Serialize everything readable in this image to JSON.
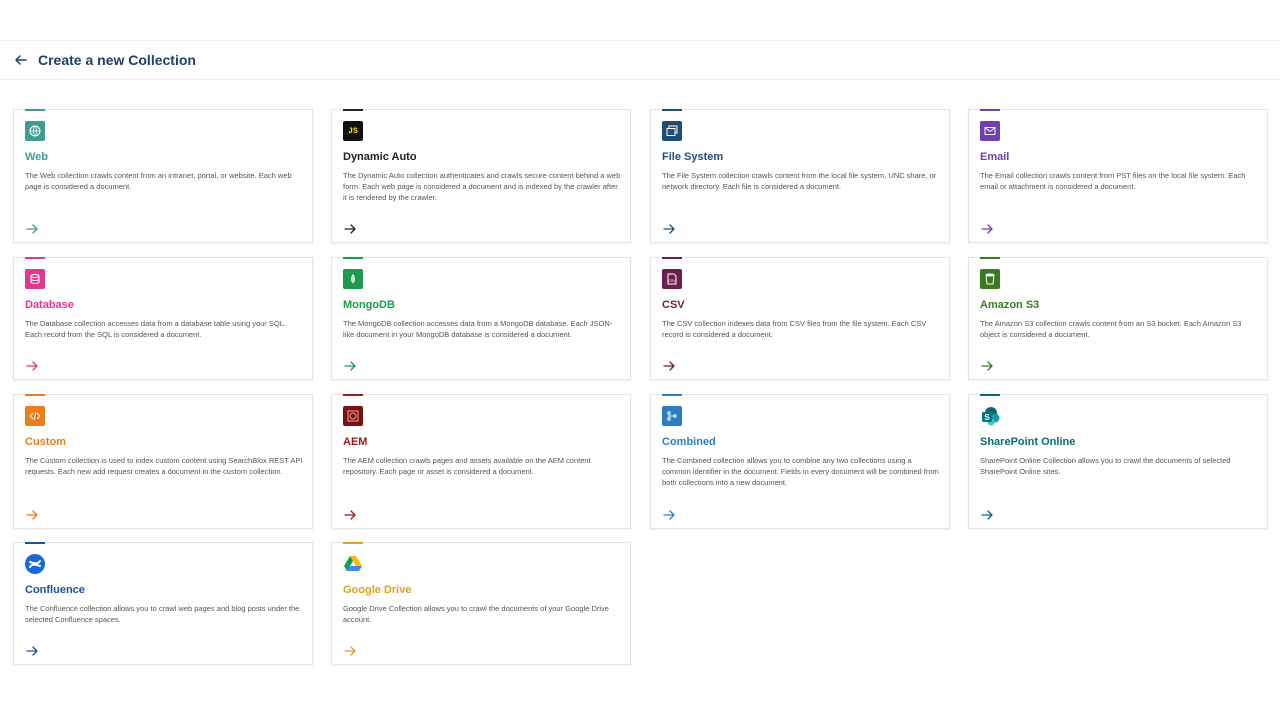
{
  "header": {
    "title": "Create a new Collection"
  },
  "cards": [
    {
      "title": "Web",
      "color": "#3f9c95",
      "icon": "globe-icon",
      "description": "The Web collection crawls content from an intranet, portal, or website. Each web page is considered a document."
    },
    {
      "title": "Dynamic Auto",
      "color": "#222222",
      "icon": "js-icon",
      "description": "The Dynamic Auto collection authenticates and crawls secure content behind a web form. Each web page is considered a document and is indexed by the crawler after it is rendered by the crawler."
    },
    {
      "title": "File System",
      "color": "#1d4e7a",
      "icon": "folder-copy-icon",
      "description": "The File System collection crawls content from the local file system, UNC share, or network directory. Each file is considered a document."
    },
    {
      "title": "Email",
      "color": "#6f3fb5",
      "icon": "mail-icon",
      "description": "The Email collection crawls content from PST files on the local file system. Each email or attachment is considered a document."
    },
    {
      "title": "Database",
      "color": "#e0378f",
      "icon": "database-icon",
      "description": "The Database collection accesses data from a database table using your SQL. Each record from the SQL is considered a document."
    },
    {
      "title": "MongoDB",
      "color": "#1e9a4f",
      "icon": "mongodb-leaf-icon",
      "description": "The MongoDB collection accesses data from a MongoDB database. Each JSON-like document in your MongoDB database is considered a document."
    },
    {
      "title": "CSV",
      "color": "#6c1f4a",
      "icon": "csv-file-icon",
      "description": "The CSV collection indexes data from CSV files from the file system. Each CSV record is considered a document."
    },
    {
      "title": "Amazon S3",
      "color": "#3a7a22",
      "icon": "s3-bucket-icon",
      "description": "The Amazon S3 collection crawls content from an S3 bucket. Each Amazon S3 object is considered a document."
    },
    {
      "title": "Custom",
      "color": "#ee7b1a",
      "icon": "code-icon",
      "description": "The Custom collection is used to index custom content using SearchBlox REST API requests. Each new add request creates a document in the custom collection."
    },
    {
      "title": "AEM",
      "color": "#9b1c1c",
      "icon": "aem-icon",
      "description": "The AEM collection crawls pages and assets available on the AEM content repository. Each page or asset is considered a document."
    },
    {
      "title": "Combined",
      "color": "#2d7fc4",
      "icon": "merge-icon",
      "description": "The Combined collection allows you to combine any two collections using a common identifier in the document. Fields in every document will be combined from both collections into a new document."
    },
    {
      "title": "SharePoint Online",
      "color": "#0b6a72",
      "icon": "sharepoint-icon",
      "description": "SharePoint Online Collection allows you to crawl the documents of selected SharePoint Online sites."
    },
    {
      "title": "Confluence",
      "color": "#1d4fa0",
      "icon": "confluence-icon",
      "description": "The Confluence collection allows you to crawl web pages and blog posts under the selected Confluence spaces."
    },
    {
      "title": "Google Drive",
      "color": "#e0a11b",
      "icon": "google-drive-icon",
      "description": "Google Drive Collection allows you to crawl the documents of your Google Drive account."
    }
  ]
}
